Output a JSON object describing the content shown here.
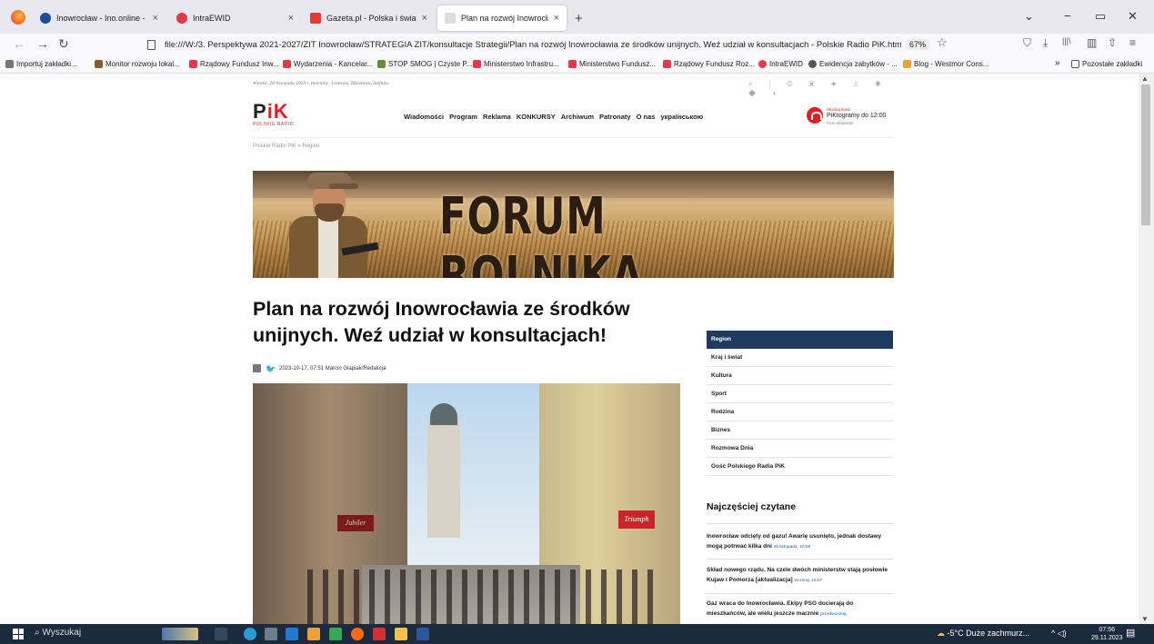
{
  "tabs": [
    {
      "title": "Inowrocław - Ino.online - wiesc",
      "close": "×",
      "color": "#1a4d9e"
    },
    {
      "title": "IntraEWID",
      "close": "",
      "color": "#e23a4a"
    },
    {
      "title": "Gazeta.pl - Polska i świat - wiad",
      "close": "×",
      "color": "#e63a2e"
    },
    {
      "title": "Plan na rozwój Inowrocławia ze",
      "close": "×",
      "color": "#e9e7ef"
    }
  ],
  "tab_close_extra": "×",
  "new_tab": "+",
  "window": {
    "chevron": "⌄",
    "min": "−",
    "restore": "▭",
    "close": "✕"
  },
  "nav": {
    "back": "←",
    "forward": "→",
    "reload": "↻"
  },
  "url": "file:///W:/3. Perspektywa 2021-2027/ZIT Inowrocław/STRATEGIA ZIT/konsultacje Strategii/Plan na rozwój Inowrocławia ze środków unijnych. Weź udział w konsultacjach - Polskie Radio PiK.htm",
  "zoom": "67%",
  "star": "☆",
  "toolbar_icons": [
    "⛉",
    "⤓",
    "|||\\",
    "▥",
    "⇧",
    "≡"
  ],
  "bookmarks": [
    {
      "label": "Importuj zakładki...",
      "color": "#777"
    },
    {
      "label": "Monitor rozwoju lokal...",
      "color": "#8b5a2b"
    },
    {
      "label": "Rządowy Fundusz Inw...",
      "color": "#e23a4a"
    },
    {
      "label": "Wydarzenia - Kancelar...",
      "color": "#e23a4a"
    },
    {
      "label": "STOP SMOG | Czyste P...",
      "color": "#6a8f3a"
    },
    {
      "label": "Ministerstwo Infrastru...",
      "color": "#e23a4a"
    },
    {
      "label": "Ministerstwo Fundusz...",
      "color": "#e23a4a"
    },
    {
      "label": "Rządowy Fundusz Roz...",
      "color": "#e23a4a"
    },
    {
      "label": "IntraEWID",
      "color": "#e23a4a"
    },
    {
      "label": "Ewidencja zabytków - ...",
      "color": "#555"
    },
    {
      "label": "Blog - Westmor Cons...",
      "color": "#e8a23a"
    }
  ],
  "bm_more": "»",
  "bm_other": "Pozostałe zakładki",
  "site": {
    "topline": "Wtorek, 28 listopada 2023 r.  Imieniny: Lesława, Zdzisława, Stefana",
    "topline_icons": "⌕ | ◎ ▣ ✦ ♙ ◉ ◆ ◖",
    "logo_main": "P",
    "logo_accent": "iK",
    "logo_sub": "POLSKIE RADIO",
    "nav": [
      "Wiadomości",
      "Program",
      "Reklama",
      "KONKURSY",
      "Archiwum",
      "Patronaty",
      "O nas",
      "українською"
    ],
    "listen_label": "Słuchaj teraz",
    "listen_show": "PiKtogramy do 12:00",
    "listen_host": "Piotr Majewski",
    "breadcrumb": "Polskie Radio PiK » Region",
    "banner_title": "FORUM ROLNIKA",
    "headline": "Plan na rozwój Inowrocławia ze środków unijnych. Weź udział w konsultacjach!",
    "meta": "2023-10-17, 07:51  Marcin Glapiak/Redakcja",
    "photo_sign_left": "Jubiler",
    "photo_sign_right": "Triumph",
    "side_menu": [
      "Region",
      "Kraj i świat",
      "Kultura",
      "Sport",
      "Rodzina",
      "Biznes",
      "Rozmowa Dnia",
      "Gość Polskiego Radia PiK"
    ],
    "popular_title": "Najczęściej czytane",
    "popular": [
      {
        "text": "Inowrocław odcięty od gazu! Awarię usunięto, jednak dostawy mogą potrwać kilka dni",
        "date": "25 listopada, 10:58"
      },
      {
        "text": "Skład nowego rządu. Na czele dwóch ministerstw stają posłowie Kujaw i Pomorza [aktualizacja]",
        "date": "wczoraj, 16:07"
      },
      {
        "text": "Gaz wraca do Inowrocławia. Ekipy PSG docierają do mieszkańców, ale wielu jeszcze marznie",
        "date": "przedwczoraj,"
      }
    ]
  },
  "taskbar": {
    "search": "Wyszukaj",
    "weather": "-5°C  Duże zachmurz...",
    "tray": "^ ◁)",
    "time": "07:56",
    "date": "29.11.2023"
  }
}
